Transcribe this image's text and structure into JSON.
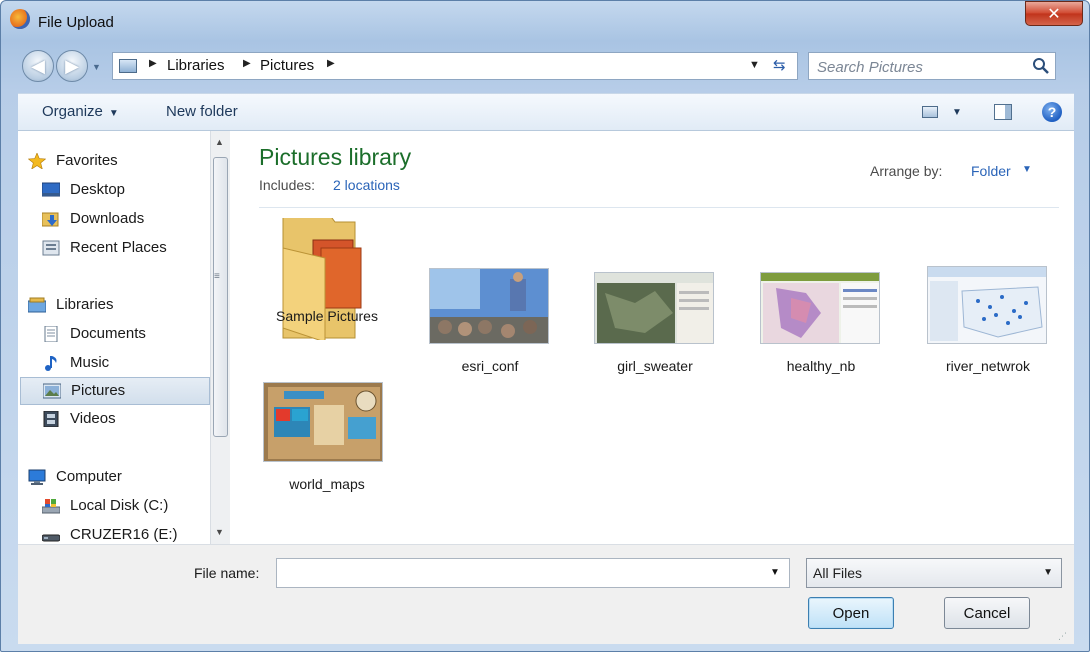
{
  "window": {
    "title": "File Upload"
  },
  "nav": {
    "breadcrumbs": [
      "Libraries",
      "Pictures"
    ],
    "search_placeholder": "Search Pictures"
  },
  "toolbar": {
    "organize": "Organize",
    "new_folder": "New folder"
  },
  "sidebar": {
    "favorites": {
      "label": "Favorites",
      "items": [
        "Desktop",
        "Downloads",
        "Recent Places"
      ]
    },
    "libraries": {
      "label": "Libraries",
      "items": [
        "Documents",
        "Music",
        "Pictures",
        "Videos"
      ],
      "selected": "Pictures"
    },
    "computer": {
      "label": "Computer",
      "items": [
        "Local Disk (C:)",
        "CRUZER16 (E:)"
      ]
    }
  },
  "content": {
    "title": "Pictures library",
    "includes_label": "Includes:",
    "includes_link": "2 locations",
    "arrange_label": "Arrange by:",
    "arrange_value": "Folder",
    "files": [
      "Sample Pictures",
      "esri_conf",
      "girl_sweater",
      "healthy_nb",
      "river_netwrok",
      "world_maps"
    ]
  },
  "footer": {
    "filename_label": "File name:",
    "filename_value": "",
    "filetype": "All Files",
    "open_label": "Open",
    "cancel_label": "Cancel"
  },
  "colors": {
    "accent_link": "#2a64b8",
    "library_title": "#1b6e2a",
    "close_button": "#c0331b"
  }
}
